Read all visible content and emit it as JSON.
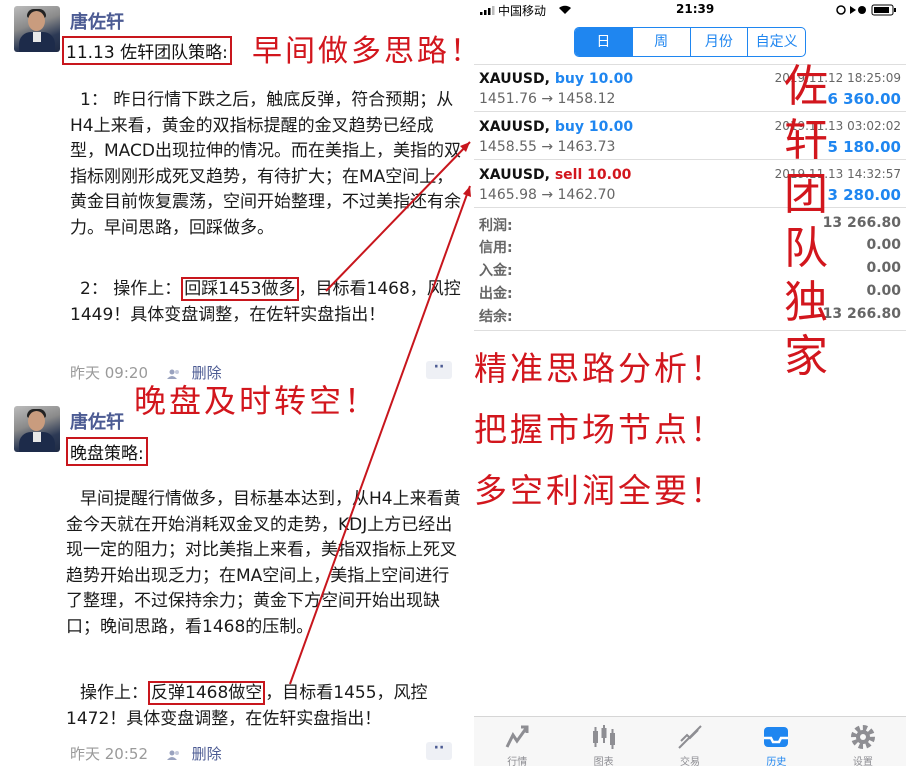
{
  "posts": [
    {
      "author": "唐佐轩",
      "title": "11.13 佐轩团队策略:",
      "p1": "1： 昨日行情下跌之后，触底反弹，符合预期；从H4上来看，黄金的双指标提醒的金叉趋势已经成型，MACD出现拉伸的情况。而在美指上，美指的双指标刚刚形成死叉趋势，有待扩大；在MA空间上，黄金目前恢复震荡，空间开始整理，不过美指还有余力。早间思路，回踩做多。",
      "p2_pre": "2： 操作上：",
      "p2_box": "回踩1453做多",
      "p2_post": "，目标看1468，风控1449！具体变盘调整，在佐轩实盘指出！",
      "time": "昨天 09:20",
      "delete": "删除"
    },
    {
      "author": "唐佐轩",
      "title": "晚盘策略:",
      "p1": "早间提醒行情做多，目标基本达到，从H4上来看黄金今天就在开始消耗双金叉的走势，KDJ上方已经出现一定的阻力；对比美指上来看，美指双指标上死叉趋势开始出现乏力；在MA空间上，美指上空间进行了整理，不过保持余力；黄金下方空间开始出现缺口；晚间思路，看1468的压制。",
      "p2_pre": "操作上：",
      "p2_box": "反弹1468做空",
      "p2_post": "，目标看1455，风控1472！具体变盘调整，在佐轩实盘指出！",
      "time": "昨天 20:52",
      "delete": "删除"
    }
  ],
  "annotations": {
    "morning": "早间做多思路！",
    "evening": "晚盘及时转空！",
    "vertical": [
      "佐",
      "轩",
      "团",
      "队",
      "独",
      "家"
    ],
    "slogans": [
      "精准思路分析！",
      "把握市场节点！",
      "多空利润全要！"
    ]
  },
  "phone": {
    "carrier": "中国移动",
    "clock": "21:39",
    "segments": [
      "日",
      "周",
      "月份",
      "自定义"
    ],
    "trades": [
      {
        "symbol": "XAUUSD,",
        "side": "buy 10.00",
        "side_type": "buy",
        "time": "2019.11.12 18:25:09",
        "prices": "1451.76 → 1458.12",
        "profit": "6 360.00"
      },
      {
        "symbol": "XAUUSD,",
        "side": "buy 10.00",
        "side_type": "buy",
        "time": "2019.11.13 03:02:02",
        "prices": "1458.55 → 1463.73",
        "profit": "5 180.00"
      },
      {
        "symbol": "XAUUSD,",
        "side": "sell 10.00",
        "side_type": "sell",
        "time": "2019.11.13 14:32:57",
        "prices": "1465.98 → 1462.70",
        "profit": "3 280.00"
      }
    ],
    "summary": [
      {
        "label": "利润:",
        "value": "13 266.80"
      },
      {
        "label": "信用:",
        "value": "0.00"
      },
      {
        "label": "入金:",
        "value": "0.00"
      },
      {
        "label": "出金:",
        "value": "0.00"
      },
      {
        "label": "结余:",
        "value": "13 266.80"
      }
    ],
    "tabs": [
      {
        "label": "行情",
        "icon": "quotes-icon"
      },
      {
        "label": "图表",
        "icon": "chart-icon"
      },
      {
        "label": "交易",
        "icon": "trade-icon"
      },
      {
        "label": "历史",
        "icon": "history-icon"
      },
      {
        "label": "设置",
        "icon": "settings-icon"
      }
    ],
    "colors": {
      "accent": "#1f86f0",
      "sell": "#d2161d",
      "annotation": "#d2161d"
    }
  }
}
